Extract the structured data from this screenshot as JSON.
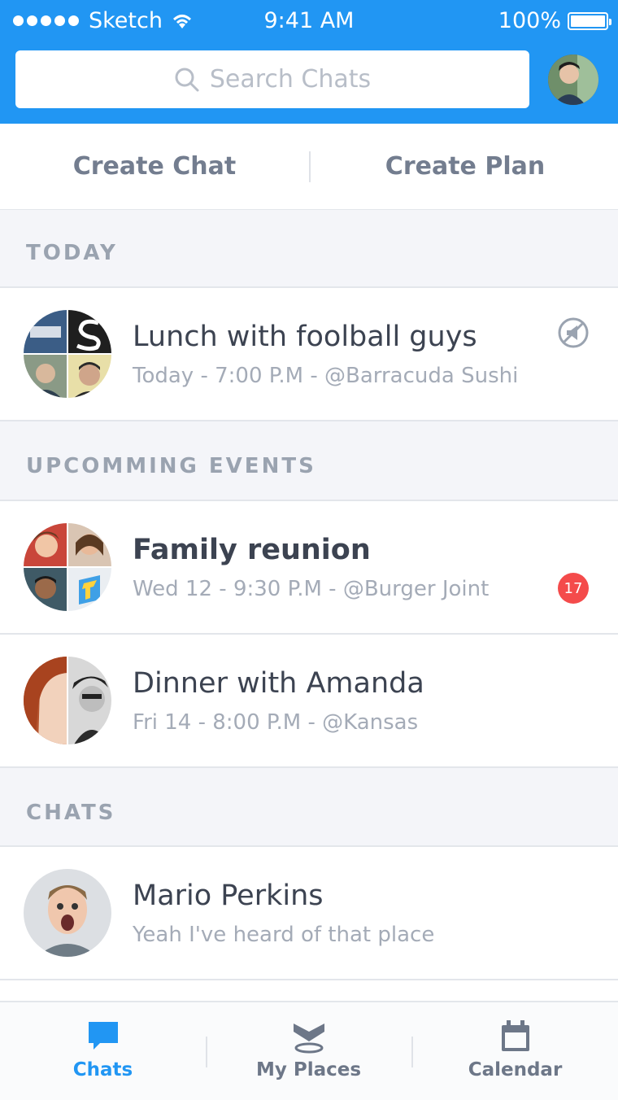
{
  "status_bar": {
    "carrier": "Sketch",
    "time": "9:41 AM",
    "battery": "100%"
  },
  "search": {
    "placeholder": "Search Chats"
  },
  "actions": {
    "create_chat": "Create Chat",
    "create_plan": "Create Plan"
  },
  "sections": {
    "today": "TODAY",
    "upcoming": "UPCOMMING EVENTS",
    "chats": "CHATS"
  },
  "today": [
    {
      "title": "Lunch with foolball guys",
      "subtitle": "Today - 7:00 P.M - @Barracuda Sushi",
      "muted_icon": "muted-megaphone-icon"
    }
  ],
  "upcoming": [
    {
      "title": "Family reunion",
      "subtitle": "Wed 12 - 9:30 P.M - @Burger Joint",
      "badge": "17"
    },
    {
      "title": "Dinner with Amanda",
      "subtitle": "Fri 14 - 8:00 P.M - @Kansas"
    }
  ],
  "chats": [
    {
      "title": "Mario Perkins",
      "subtitle": "Yeah I've heard of that place"
    }
  ],
  "tabs": [
    {
      "label": "Chats",
      "icon": "chat-bubble-icon",
      "active": true
    },
    {
      "label": "My Places",
      "icon": "places-icon",
      "active": false
    },
    {
      "label": "Calendar",
      "icon": "calendar-icon",
      "active": false
    }
  ],
  "colors": {
    "accent": "#2196f3",
    "badge": "#f44b4b",
    "section_bg": "#f4f5f9"
  }
}
